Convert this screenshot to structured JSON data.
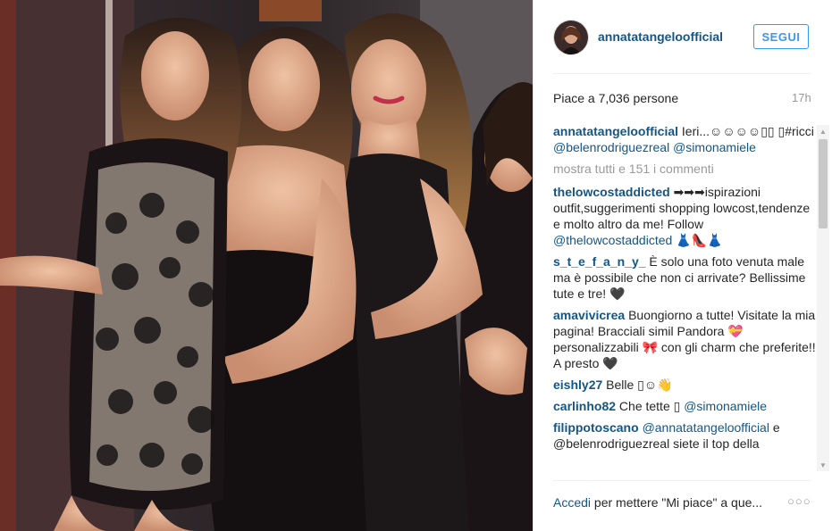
{
  "post": {
    "username": "annatatangeloofficial",
    "follow_label": "SEGUI",
    "likes": "Piace a 7,036 persone",
    "time": "17h",
    "view_all": "mostra tutti e 151 i commenti",
    "caption": {
      "user": "annatatangeloofficial",
      "text": "Ieri...☺☺☺☺▯▯ ▯#ricci",
      "mention1": "@belenrodriguezreal",
      "mention2": "@simonamiele"
    },
    "comments": [
      {
        "user": "thelowcostaddicted",
        "text": "➡➡➡ispirazioni outfit,suggerimenti shopping lowcost,tendenze e molto altro da me! Follow ",
        "link": "@thelowcostaddicted",
        "tail": " 👗👠👗"
      },
      {
        "user": "s_t_e_f_a_n_y_",
        "text": "È solo una foto venuta male ma è possibile che non ci arrivate? Bellissime tute e tre! 🖤",
        "link": "",
        "tail": ""
      },
      {
        "user": "amavivicrea",
        "text": "Buongiorno a tutte! Visitate la mia pagina! Bracciali simil Pandora 💝 personalizzabili 🎀 con gli charm che preferite!! A presto 🖤",
        "link": "",
        "tail": ""
      },
      {
        "user": "eishly27",
        "text": "Belle ▯☺👋",
        "link": "",
        "tail": ""
      },
      {
        "user": "carlinho82",
        "text": "Che tette ▯ ",
        "link": "@simonamiele",
        "tail": ""
      },
      {
        "user": "filippotoscano",
        "text": "",
        "link": "@annatatangeloofficial",
        "tail": " e @belenrodriguezreal siete il top della"
      }
    ],
    "footer_login": "Accedi",
    "footer_text": " per mettere \"Mi piace\" a que...",
    "more_options": "○○○"
  },
  "icons": {
    "avatar": "profile-avatar",
    "scroll_up": "arrow-up-icon",
    "scroll_down": "arrow-down-icon"
  },
  "colors": {
    "link": "#125688",
    "follow": "#3897f0",
    "muted": "#999999"
  }
}
